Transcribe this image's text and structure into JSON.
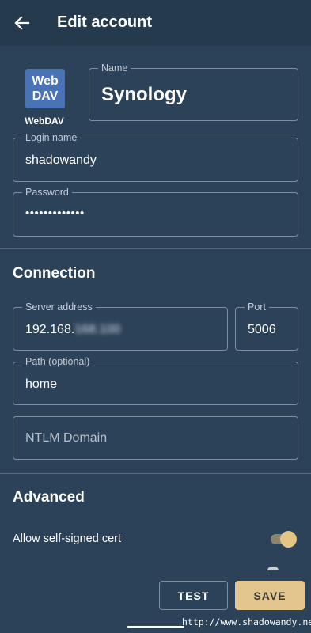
{
  "appbar": {
    "title": "Edit account",
    "back_icon": "arrow-left-icon"
  },
  "provider": {
    "logo_line1": "Web",
    "logo_line2": "DAV",
    "caption": "WebDAV"
  },
  "fields": {
    "name": {
      "label": "Name",
      "value": "Synology"
    },
    "login": {
      "label": "Login name",
      "value": "shadowandy"
    },
    "password": {
      "label": "Password",
      "value": "•••••••••••••"
    }
  },
  "connection": {
    "title": "Connection",
    "server": {
      "label": "Server address",
      "value_visible": "192.168.",
      "value_blurred": "168.100"
    },
    "port": {
      "label": "Port",
      "value": "5006"
    },
    "path": {
      "label": "Path (optional)",
      "value": "home"
    },
    "ntlm": {
      "placeholder": "NTLM Domain"
    }
  },
  "advanced": {
    "title": "Advanced",
    "self_signed": {
      "label": "Allow self-signed cert",
      "enabled": true
    }
  },
  "actions": {
    "test_label": "TEST",
    "save_label": "SAVE"
  },
  "watermark": "http://www.shadowandy.net",
  "colors": {
    "background": "#2c4259",
    "appbar": "#263a4e",
    "accent": "#e2c68e",
    "logo": "#4a73b6"
  }
}
